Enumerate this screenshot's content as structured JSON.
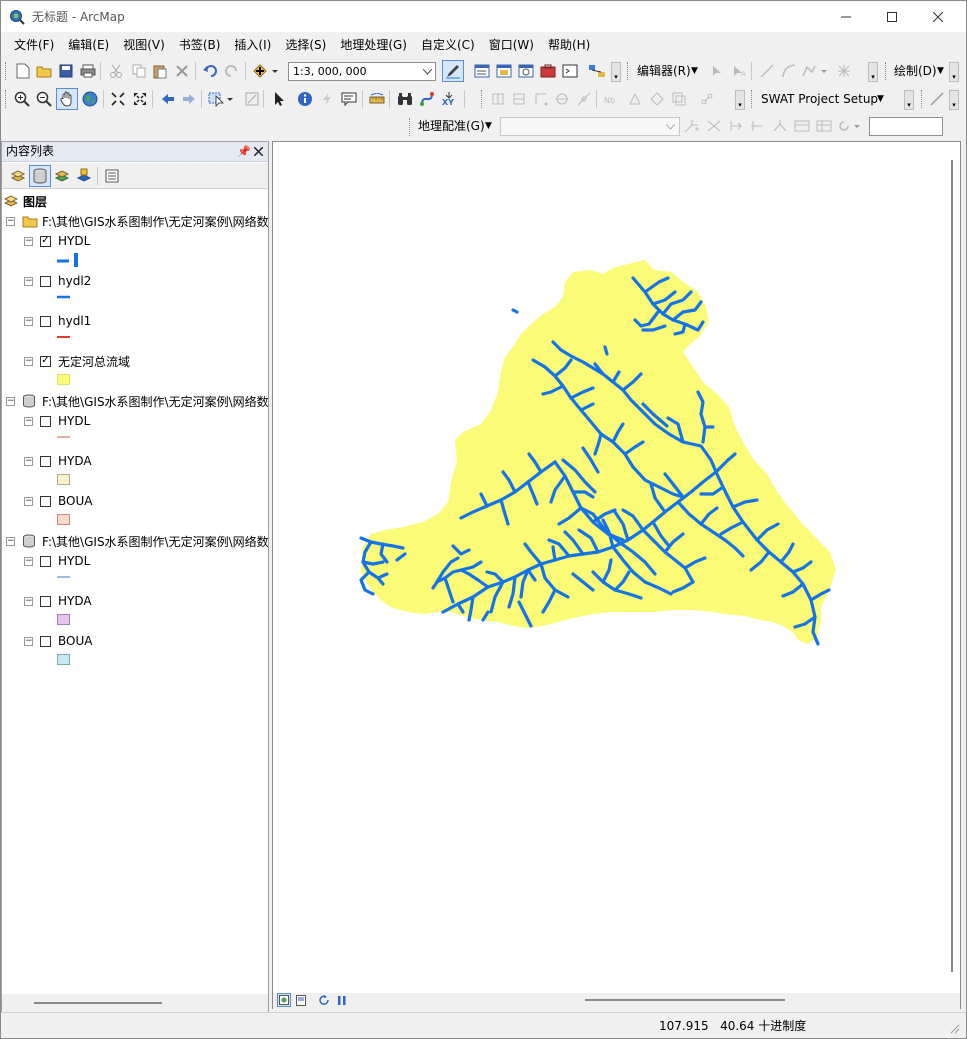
{
  "window": {
    "title": "无标题 - ArcMap"
  },
  "menu": [
    {
      "label": "文件(F)"
    },
    {
      "label": "编辑(E)"
    },
    {
      "label": "视图(V)"
    },
    {
      "label": "书签(B)"
    },
    {
      "label": "插入(I)"
    },
    {
      "label": "选择(S)"
    },
    {
      "label": "地理处理(G)"
    },
    {
      "label": "自定义(C)"
    },
    {
      "label": "窗口(W)"
    },
    {
      "label": "帮助(H)"
    }
  ],
  "toolbar": {
    "scale": "1:3, 000, 000",
    "editor_label": "编辑器(R)",
    "draw_label": "绘制(D)",
    "swat_label": "SWAT Project Setup",
    "georef_label": "地理配准(G)"
  },
  "toc": {
    "title": "内容列表",
    "root_label": "图层",
    "groups": [
      {
        "label": "F:\\其他\\GIS水系图制作\\无定河案例\\网络数",
        "layers": [
          {
            "name": "HYDL",
            "checked": true,
            "symbol": "line",
            "color": "#1473e6"
          },
          {
            "name": "hydl2",
            "checked": false,
            "symbol": "line",
            "color": "#1473e6"
          },
          {
            "name": "hydl1",
            "checked": false,
            "symbol": "line",
            "color": "#e0402a"
          },
          {
            "name": "无定河总流域",
            "checked": true,
            "symbol": "fill",
            "color": "#fbfb78"
          }
        ]
      },
      {
        "label": "F:\\其他\\GIS水系图制作\\无定河案例\\网络数",
        "layers": [
          {
            "name": "HYDL",
            "checked": false,
            "symbol": "line",
            "color": "#b8634a"
          },
          {
            "name": "HYDA",
            "checked": false,
            "symbol": "fill",
            "color": "#f9f2cc"
          },
          {
            "name": "BOUA",
            "checked": false,
            "symbol": "fill",
            "color": "#f9d9cc"
          }
        ]
      },
      {
        "label": "F:\\其他\\GIS水系图制作\\无定河案例\\网络数",
        "layers": [
          {
            "name": "HYDL",
            "checked": false,
            "symbol": "line",
            "color": "#3a78c9"
          },
          {
            "name": "HYDA",
            "checked": false,
            "symbol": "fill",
            "color": "#e6c6ee"
          },
          {
            "name": "BOUA",
            "checked": false,
            "symbol": "fill",
            "color": "#c6e8f2"
          }
        ]
      }
    ]
  },
  "status": {
    "x": "107.915",
    "y": "40.64",
    "unit": "十进制度"
  },
  "map": {
    "basin_color": "#fbfb78",
    "river_color": "#1473e6"
  }
}
